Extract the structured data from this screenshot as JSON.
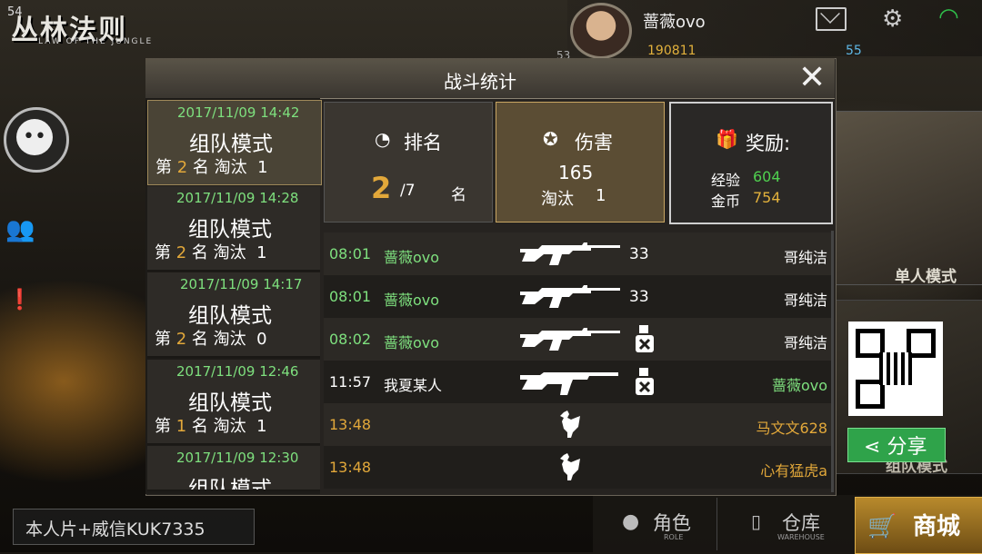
{
  "fps": "54",
  "logo": {
    "title": "丛林法则",
    "subtitle": "LAW OF THE JUNGLE"
  },
  "player": {
    "name": "蔷薇ovo",
    "gold": "190811",
    "gems": "55",
    "level": "53"
  },
  "left": {
    "chat_input": "本人片+威信KUK7335"
  },
  "right": {
    "single_mode": "单人模式",
    "team_mode": "组队模式",
    "share": "分享"
  },
  "bottom": {
    "role": "角色",
    "role_sub": "ROLE",
    "warehouse": "仓库",
    "warehouse_sub": "WAREHOUSE",
    "shop": "商城"
  },
  "dialog": {
    "title": "战斗统计",
    "close": "✕",
    "matches": [
      {
        "date": "2017/11/09 14:42",
        "mode": "组队模式",
        "pre": "第",
        "rank": "2",
        "mid": "名 淘汰",
        "kills": "1"
      },
      {
        "date": "2017/11/09 14:28",
        "mode": "组队模式",
        "pre": "第",
        "rank": "2",
        "mid": "名 淘汰",
        "kills": "1"
      },
      {
        "date": "2017/11/09 14:17",
        "mode": "组队模式",
        "pre": "第",
        "rank": "2",
        "mid": "名 淘汰",
        "kills": "0"
      },
      {
        "date": "2017/11/09 12:46",
        "mode": "组队模式",
        "pre": "第",
        "rank": "1",
        "mid": "名 淘汰",
        "kills": "1"
      },
      {
        "date": "2017/11/09 12:30",
        "mode": "组队模式"
      }
    ],
    "rank": {
      "label": "排名",
      "value": "2",
      "total": "/7",
      "unit": "名"
    },
    "damage": {
      "label": "伤害",
      "value": "165",
      "kills_label": "淘汰",
      "kills": "1"
    },
    "reward": {
      "label": "奖励:",
      "exp_label": "经验",
      "exp": "604",
      "coin_label": "金币",
      "coin": "754"
    },
    "feed": [
      {
        "time": "08:01",
        "attacker": "蔷薇ovo",
        "weapon": "rifle-m4",
        "damage": "33",
        "victim": "哥纯洁"
      },
      {
        "time": "08:01",
        "attacker": "蔷薇ovo",
        "weapon": "rifle-m4",
        "damage": "33",
        "victim": "哥纯洁"
      },
      {
        "time": "08:02",
        "attacker": "蔷薇ovo",
        "weapon": "rifle-m4",
        "knockdown": true,
        "victim": "哥纯洁"
      },
      {
        "time": "11:57",
        "attacker": "我夏某人",
        "weapon": "rifle-ak",
        "knockdown": true,
        "victim": "蔷薇ovo"
      },
      {
        "time": "13:48",
        "weapon": "chicken",
        "victim": "马文文628"
      },
      {
        "time": "13:48",
        "weapon": "chicken",
        "victim": "心有猛虎a"
      }
    ]
  },
  "colors": {
    "green": "#7ee07e",
    "gold": "#e2a83a",
    "share_green": "#2fa34a"
  }
}
